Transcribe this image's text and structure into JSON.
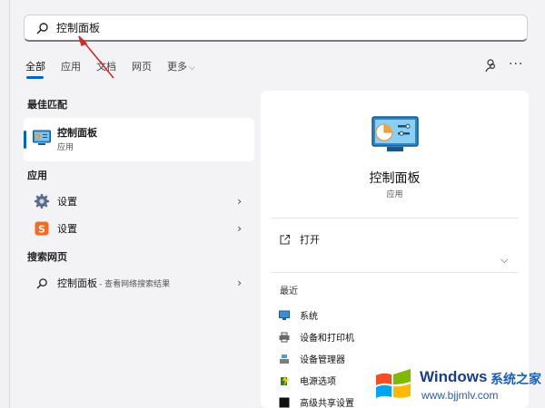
{
  "search": {
    "query": "控制面板"
  },
  "tabs": [
    {
      "label": "全部"
    },
    {
      "label": "应用"
    },
    {
      "label": "文档"
    },
    {
      "label": "网页"
    },
    {
      "label": "更多"
    }
  ],
  "toolbar": {
    "more_icon": "more-dots-icon",
    "accounts_icon": "accounts-icon"
  },
  "sections": {
    "best_match": "最佳匹配",
    "apps": "应用",
    "web": "搜索网页"
  },
  "best_match_item": {
    "title": "控制面板",
    "type": "应用"
  },
  "apps": [
    {
      "label": "设置",
      "icon": "gear-icon"
    },
    {
      "label": "设置",
      "icon": "sogou-icon"
    }
  ],
  "web_result": {
    "label": "控制面板",
    "suffix": "- 查看网络搜索结果"
  },
  "detail": {
    "title": "控制面板",
    "type": "应用",
    "open_label": "打开",
    "recent_label": "最近",
    "recent": [
      {
        "label": "系统"
      },
      {
        "label": "设备和打印机"
      },
      {
        "label": "设备管理器"
      },
      {
        "label": "电源选项"
      },
      {
        "label": "高级共享设置"
      }
    ]
  },
  "watermark": {
    "brand": "Windows",
    "brand_cn": "系统之家",
    "url": "www.bjjmlv.com"
  },
  "colors": {
    "accent": "#0067c0",
    "annotation_arrow": "#d22b2b"
  }
}
